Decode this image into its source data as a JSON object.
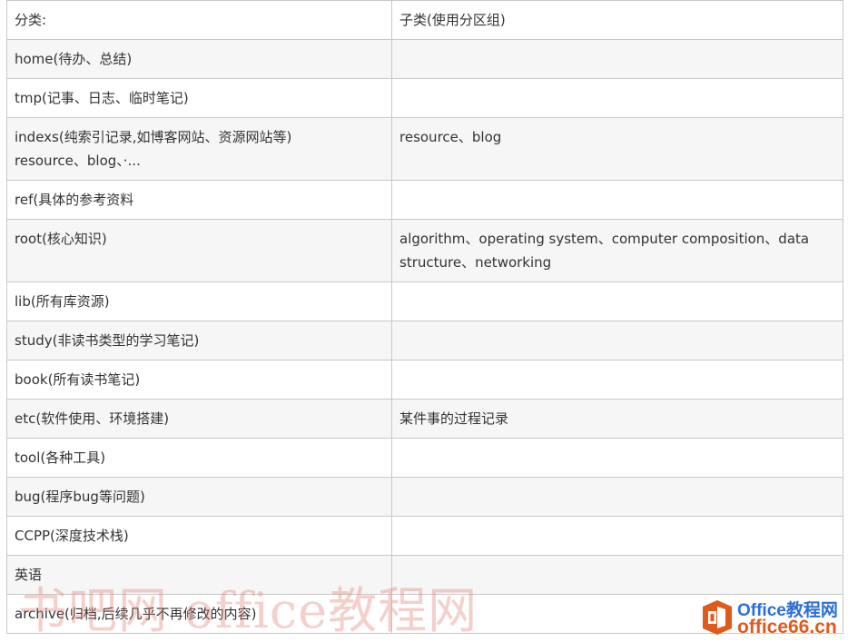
{
  "table": {
    "header": {
      "col1": "分类:",
      "col2": "子类(使用分区组)"
    },
    "rows": [
      {
        "category": [
          "home(待办、总结)"
        ],
        "sub": [
          ""
        ]
      },
      {
        "category": [
          "tmp(记事、日志、临时笔记)"
        ],
        "sub": [
          ""
        ]
      },
      {
        "category": [
          "indexs(纯索引记录,如博客网站、资源网站等)",
          "resource、blog、·..."
        ],
        "sub": [
          "resource、blog"
        ]
      },
      {
        "category": [
          "ref(具体的参考资料"
        ],
        "sub": [
          ""
        ]
      },
      {
        "category": [
          "root(核心知识)"
        ],
        "sub": [
          "algorithm、operating system、computer composition、data",
          "structure、networking"
        ]
      },
      {
        "category": [
          "lib(所有库资源)"
        ],
        "sub": [
          ""
        ]
      },
      {
        "category": [
          "study(非读书类型的学习笔记)"
        ],
        "sub": [
          ""
        ]
      },
      {
        "category": [
          "book(所有读书笔记)"
        ],
        "sub": [
          ""
        ]
      },
      {
        "category": [
          "etc(软件使用、环境搭建)"
        ],
        "sub": [
          "某件事的过程记录"
        ]
      },
      {
        "category": [
          "tool(各种工具)"
        ],
        "sub": [
          ""
        ]
      },
      {
        "category": [
          "bug(程序bug等问题)"
        ],
        "sub": [
          ""
        ]
      },
      {
        "category": [
          "CCPP(深度技术栈)"
        ],
        "sub": [
          ""
        ]
      },
      {
        "category": [
          "英语"
        ],
        "sub": [
          ""
        ]
      },
      {
        "category": [
          "archive(归档,后续几乎不再修改的内容)"
        ],
        "sub": [
          ""
        ]
      }
    ]
  },
  "watermark": {
    "text": "书吧网 office教程网",
    "logo_line1": "Office教程网",
    "logo_line2": "office66.cn",
    "icon": "office-logo-icon",
    "colors": {
      "text": "#dc786e",
      "logo_blue": "#2c6fd6",
      "logo_orange": "#e05a1c"
    }
  }
}
